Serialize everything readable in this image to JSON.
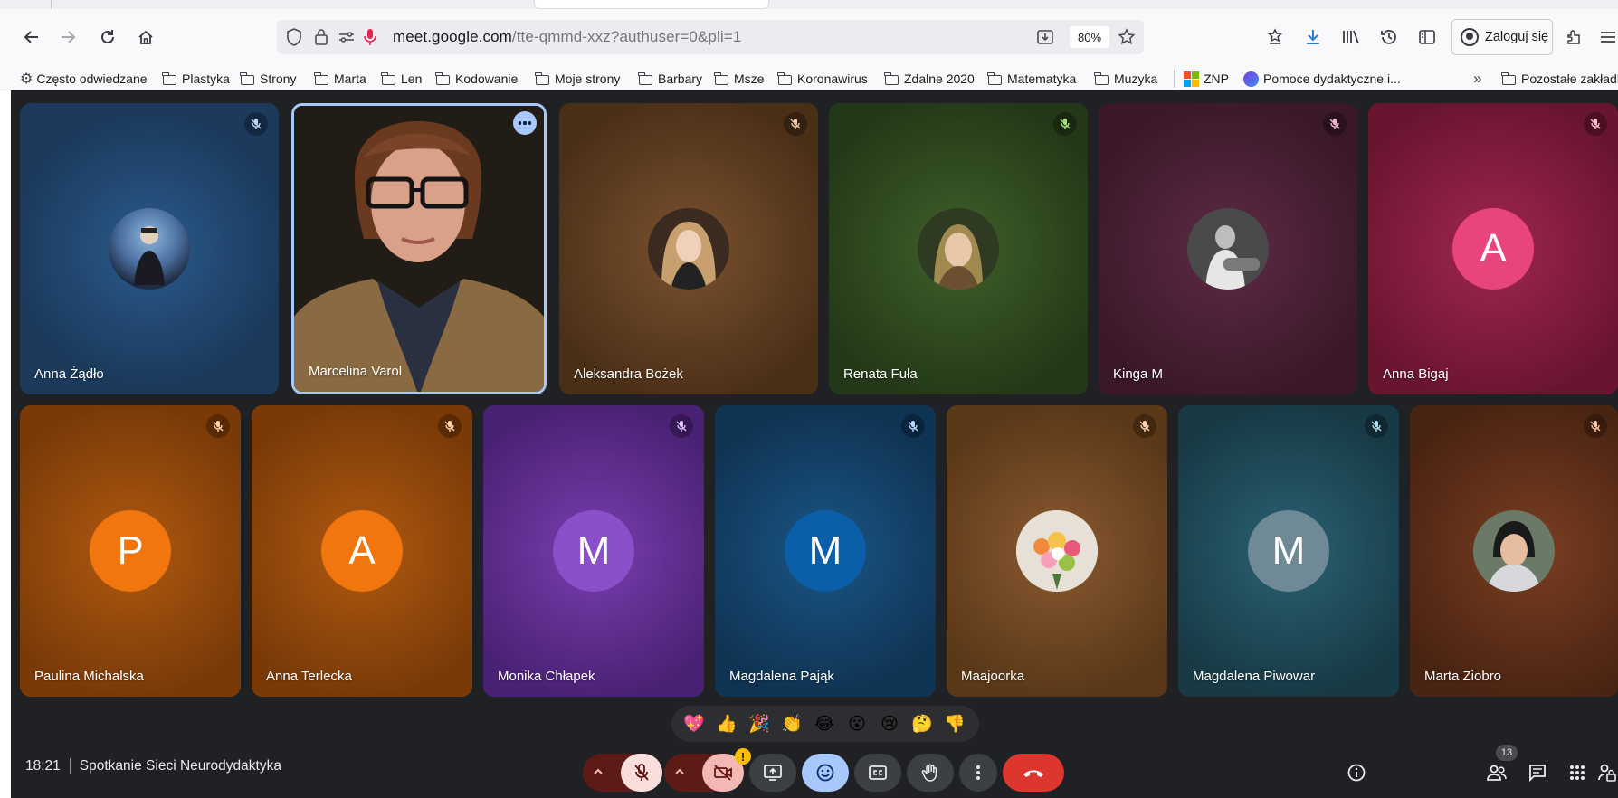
{
  "browser": {
    "url_host": "meet.google.com",
    "url_path": "/tte-qmmd-xxz?authuser=0&pli=1",
    "zoom": "80%",
    "login_label": "Zaloguj się",
    "bookmarks": [
      {
        "label": "Często odwiedzane",
        "icon": "gear-icon"
      },
      {
        "label": "Plastyka",
        "icon": "folder-icon"
      },
      {
        "label": "Strony",
        "icon": "folder-icon"
      },
      {
        "label": "Marta",
        "icon": "folder-icon"
      },
      {
        "label": "Len",
        "icon": "folder-icon"
      },
      {
        "label": "Kodowanie",
        "icon": "folder-icon"
      },
      {
        "label": "Moje strony",
        "icon": "folder-icon"
      },
      {
        "label": "Barbary",
        "icon": "folder-icon"
      },
      {
        "label": "Msze",
        "icon": "folder-icon"
      },
      {
        "label": "Koronawirus",
        "icon": "folder-icon"
      },
      {
        "label": "Zdalne 2020",
        "icon": "folder-icon"
      },
      {
        "label": "Matematyka",
        "icon": "folder-icon"
      },
      {
        "label": "Muzyka",
        "icon": "folder-icon"
      },
      {
        "label": "ZNP",
        "icon": "windows-logo-icon"
      },
      {
        "label": "Pomoce dydaktyczne i...",
        "icon": "swirl-logo-icon"
      },
      {
        "label": "Pozostałe zakładki",
        "icon": "folder-icon"
      }
    ]
  },
  "meeting": {
    "time": "18:21",
    "title": "Spotkanie Sieci Neurodydaktyka",
    "participant_count": "13",
    "participants_row1": [
      {
        "name": "Anna Żądło",
        "avatar": "photo",
        "bg": "#1b3a5c"
      },
      {
        "name": "Marcelina Varol",
        "avatar": "video",
        "bg": "#2b2116"
      },
      {
        "name": "Aleksandra Bożek",
        "avatar": "photo",
        "bg": "#5a3a1c"
      },
      {
        "name": "Renata Fuła",
        "avatar": "photo",
        "bg": "#2c4220"
      },
      {
        "name": "Kinga M",
        "avatar": "photo",
        "bg": "#4a1e35"
      },
      {
        "name": "Anna Bigaj",
        "avatar": "A",
        "bg": "#7a1c3a",
        "avatar_color": "#e8457a"
      }
    ],
    "participants_row2": [
      {
        "name": "Paulina Michalska",
        "avatar": "P",
        "bg": "#8a4208",
        "avatar_color": "#f0760d"
      },
      {
        "name": "Anna Terlecka",
        "avatar": "A",
        "bg": "#8a4208",
        "avatar_color": "#f0760d"
      },
      {
        "name": "Monika Chłapek",
        "avatar": "M",
        "bg": "#5b2888",
        "avatar_color": "#8a4fc9"
      },
      {
        "name": "Magdalena Pająk",
        "avatar": "M",
        "bg": "#124065",
        "avatar_color": "#0b5ea8"
      },
      {
        "name": "Maajoorka",
        "avatar": "photo",
        "bg": "#6e4420"
      },
      {
        "name": "Magdalena Piwowar",
        "avatar": "M",
        "bg": "#1f4c5c",
        "avatar_color": "#6f8a96"
      },
      {
        "name": "Marta Ziobro",
        "avatar": "photo",
        "bg": "#5a2e1a"
      }
    ],
    "reactions": [
      "💖",
      "👍",
      "🎉",
      "👏",
      "😂",
      "😮",
      "😢",
      "🤔",
      "👎"
    ]
  }
}
